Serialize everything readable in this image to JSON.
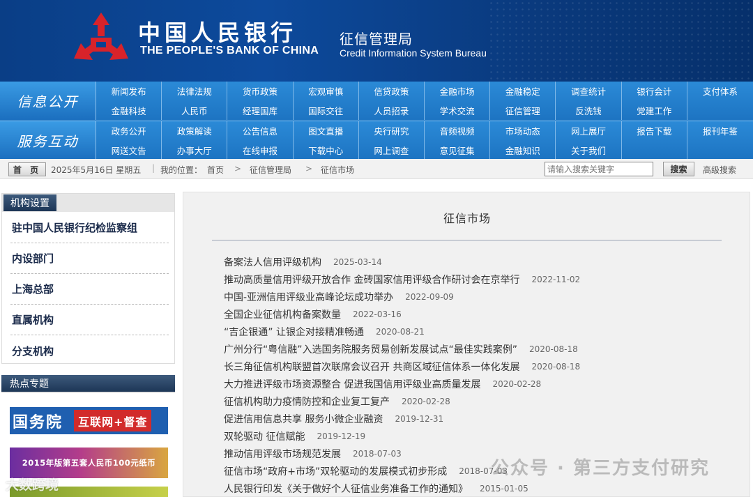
{
  "header": {
    "bank_name_cn": "中国人民银行",
    "bank_name_en": "THE PEOPLE'S BANK OF CHINA",
    "bureau_cn": "征信管理局",
    "bureau_en": "Credit Information System Bureau",
    "logo_color": "#d8232a"
  },
  "nav": {
    "section1_label": "信息公开",
    "section1_items": [
      "新闻发布",
      "法律法规",
      "货币政策",
      "宏观审慎",
      "信贷政策",
      "金融市场",
      "金融稳定",
      "调查统计",
      "银行会计",
      "支付体系",
      "金融科技",
      "人民币",
      "经理国库",
      "国际交往",
      "人员招录",
      "学术交流",
      "征信管理",
      "反洗钱",
      "党建工作",
      ""
    ],
    "section2_label": "服务互动",
    "section2_items": [
      "政务公开",
      "政策解读",
      "公告信息",
      "图文直播",
      "央行研究",
      "音频视频",
      "市场动态",
      "网上展厅",
      "报告下载",
      "报刊年鉴",
      "网送文告",
      "办事大厅",
      "在线申报",
      "下载中心",
      "网上调查",
      "意见征集",
      "金融知识",
      "关于我们",
      "",
      ""
    ]
  },
  "crumbbar": {
    "home_label": "首 页",
    "date": "2025年5月16日 星期五",
    "sep": "|",
    "location_label": "我的位置：",
    "crumb_home": "首页",
    "arrow": ">",
    "crumb_bureau": "征信管理局",
    "crumb_market": "征信市场",
    "search_placeholder": "请输入搜索关键字",
    "search_button": "搜索",
    "advanced_search": "高级搜索"
  },
  "sidebar": {
    "org_title": "机构设置",
    "org_items": [
      "驻中国人民银行纪检监察组",
      "内设部门",
      "上海总部",
      "直属机构",
      "分支机构"
    ],
    "topics_title": "热点专题",
    "banner1_left": "国务院",
    "banner1_right": "互联网+督查",
    "banner2": "2015年版第五套人民币100元纸币"
  },
  "main": {
    "title": "征信市场",
    "articles": [
      {
        "title": "备案法人信用评级机构",
        "date": "2025-03-14"
      },
      {
        "title": "推动高质量信用评级开放合作 金砖国家信用评级合作研讨会在京举行",
        "date": "2022-11-02"
      },
      {
        "title": "中国-亚洲信用评级业高峰论坛成功举办",
        "date": "2022-09-09"
      },
      {
        "title": "全国企业征信机构备案数量",
        "date": "2022-03-16"
      },
      {
        "title": "“吉企银通” 让银企对接精准畅通",
        "date": "2020-08-21"
      },
      {
        "title": "广州分行“粤信融”入选国务院服务贸易创新发展试点“最佳实践案例”",
        "date": "2020-08-18"
      },
      {
        "title": "长三角征信机构联盟首次联席会议召开 共商区域征信体系一体化发展",
        "date": "2020-08-18"
      },
      {
        "title": "大力推进评级市场资源整合 促进我国信用评级业高质量发展",
        "date": "2020-02-28"
      },
      {
        "title": "征信机构助力疫情防控和企业复工复产",
        "date": "2020-02-28"
      },
      {
        "title": "促进信用信息共享 服务小微企业融资",
        "date": "2019-12-31"
      },
      {
        "title": "双轮驱动 征信赋能",
        "date": "2019-12-19"
      },
      {
        "title": "推动信用评级市场规范发展",
        "date": "2018-07-03"
      },
      {
        "title": "征信市场“政府+市场”双轮驱动的发展模式初步形成",
        "date": "2018-07-03"
      },
      {
        "title": "人民银行印发《关于做好个人征信业务准备工作的通知》",
        "date": "2015-01-05"
      }
    ]
  },
  "watermark": {
    "right": "公众号 · 第三方支付研究",
    "left": "大数跨境"
  }
}
